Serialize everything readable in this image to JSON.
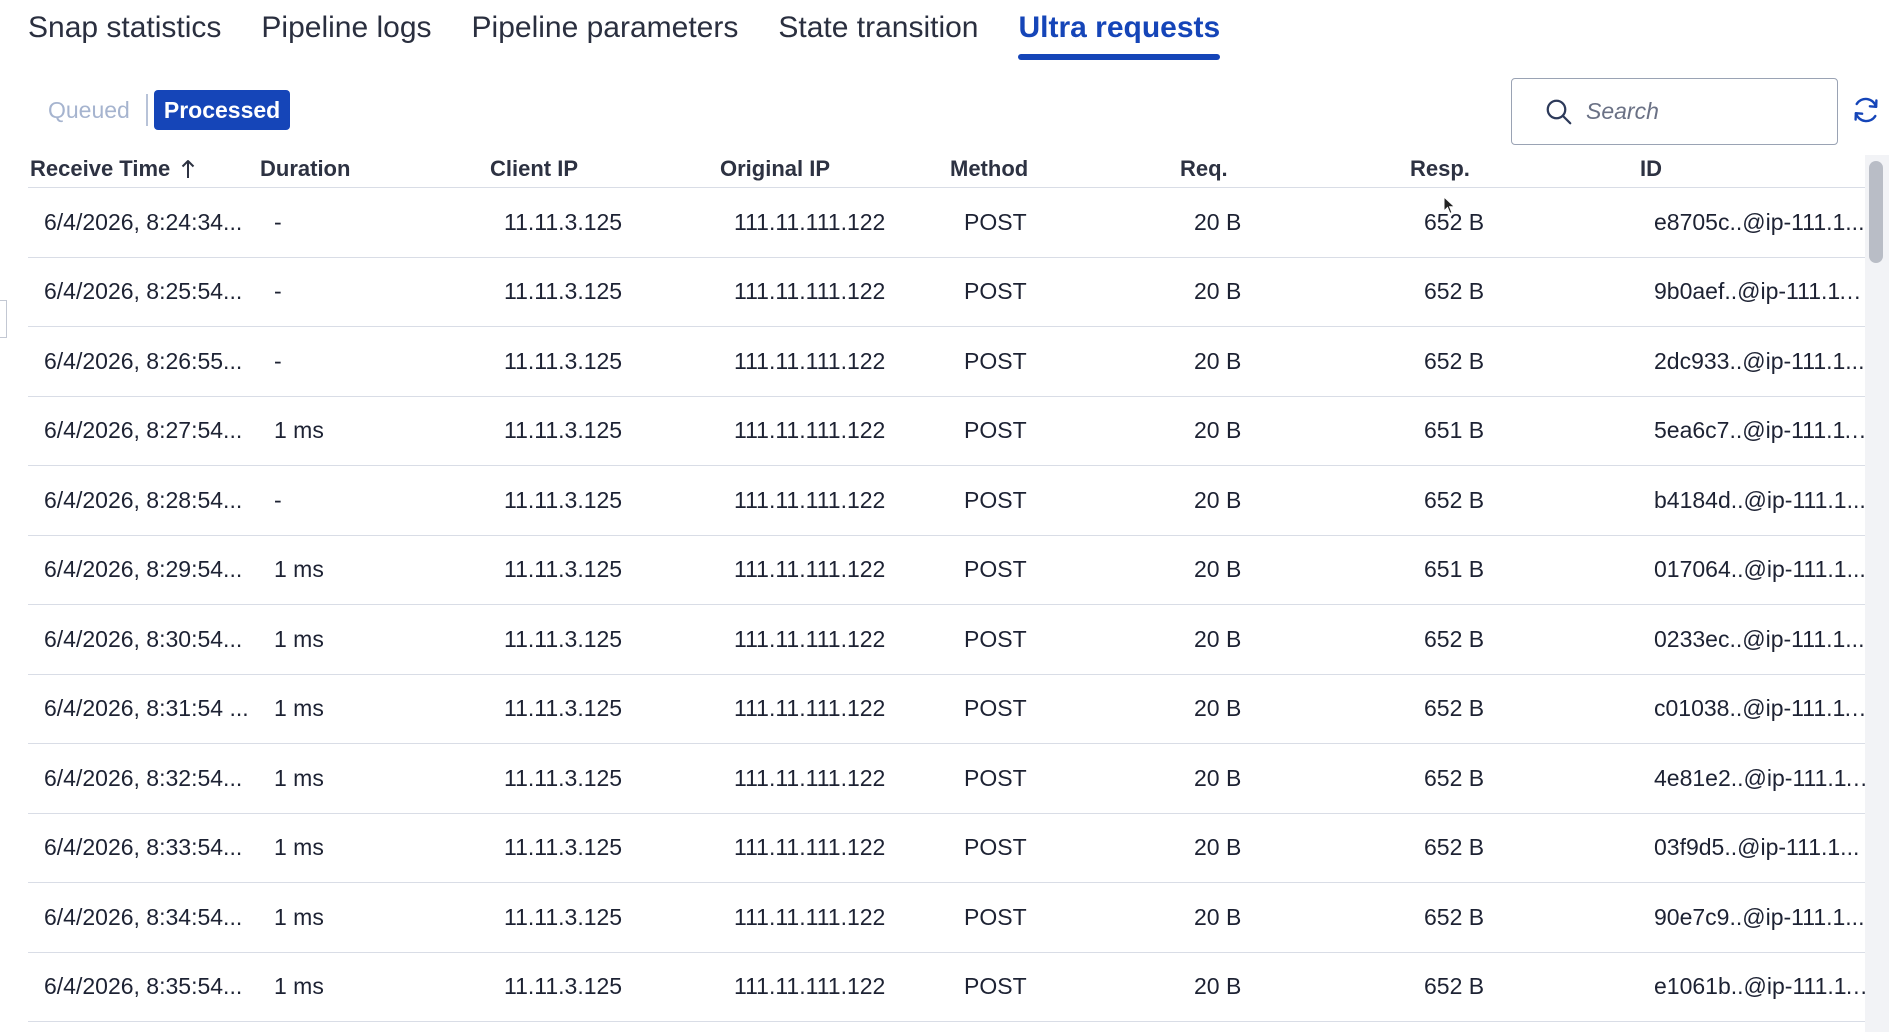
{
  "tabs": [
    {
      "label": "Snap statistics"
    },
    {
      "label": "Pipeline logs"
    },
    {
      "label": "Pipeline parameters"
    },
    {
      "label": "State transition"
    },
    {
      "label": "Ultra requests",
      "active": true
    }
  ],
  "toggle": {
    "queued": "Queued",
    "processed": "Processed",
    "selected": "Processed"
  },
  "search": {
    "placeholder": "Search",
    "value": ""
  },
  "icons": {
    "search": "search-icon",
    "refresh": "refresh-icon",
    "sort": "arrow-up-icon"
  },
  "colors": {
    "accent": "#1545b8",
    "border": "#d9dde6",
    "text": "#1d2233"
  },
  "table": {
    "columns": [
      "Receive Time",
      "Duration",
      "Client IP",
      "Original IP",
      "Method",
      "Req.",
      "Resp.",
      "ID"
    ],
    "sort": {
      "column": "Receive Time",
      "direction": "ascending"
    },
    "rows": [
      [
        "6/4/2026, 8:24:34...",
        "-",
        "11.11.3.125",
        "111.11.111.122",
        "POST",
        "20 B",
        "652 B",
        "e8705c..@ip-111.1..."
      ],
      [
        "6/4/2026, 8:25:54...",
        "-",
        "11.11.3.125",
        "111.11.111.122",
        "POST",
        "20 B",
        "652 B",
        "9b0aef..@ip-111.11..."
      ],
      [
        "6/4/2026, 8:26:55...",
        "-",
        "11.11.3.125",
        "111.11.111.122",
        "POST",
        "20 B",
        "652 B",
        "2dc933..@ip-111.1..."
      ],
      [
        "6/4/2026, 8:27:54...",
        "1 ms",
        "11.11.3.125",
        "111.11.111.122",
        "POST",
        "20 B",
        "651 B",
        "5ea6c7..@ip-111.11..."
      ],
      [
        "6/4/2026, 8:28:54...",
        "-",
        "11.11.3.125",
        "111.11.111.122",
        "POST",
        "20 B",
        "652 B",
        "b4184d..@ip-111.1..."
      ],
      [
        "6/4/2026, 8:29:54...",
        "1 ms",
        "11.11.3.125",
        "111.11.111.122",
        "POST",
        "20 B",
        "651 B",
        "017064..@ip-111.1..."
      ],
      [
        "6/4/2026, 8:30:54...",
        "1 ms",
        "11.11.3.125",
        "111.11.111.122",
        "POST",
        "20 B",
        "652 B",
        "0233ec..@ip-111.1..."
      ],
      [
        "6/4/2026, 8:31:54 ...",
        "1 ms",
        "11.11.3.125",
        "111.11.111.122",
        "POST",
        "20 B",
        "652 B",
        "c01038..@ip-111.11..."
      ],
      [
        "6/4/2026, 8:32:54...",
        "1 ms",
        "11.11.3.125",
        "111.11.111.122",
        "POST",
        "20 B",
        "652 B",
        "4e81e2..@ip-111.11..."
      ],
      [
        "6/4/2026, 8:33:54...",
        "1 ms",
        "11.11.3.125",
        "111.11.111.122",
        "POST",
        "20 B",
        "652 B",
        "03f9d5..@ip-111.1..."
      ],
      [
        "6/4/2026, 8:34:54...",
        "1 ms",
        "11.11.3.125",
        "111.11.111.122",
        "POST",
        "20 B",
        "652 B",
        "90e7c9..@ip-111.1..."
      ],
      [
        "6/4/2026, 8:35:54...",
        "1 ms",
        "11.11.3.125",
        "111.11.111.122",
        "POST",
        "20 B",
        "652 B",
        "e1061b..@ip-111.11..."
      ]
    ]
  }
}
